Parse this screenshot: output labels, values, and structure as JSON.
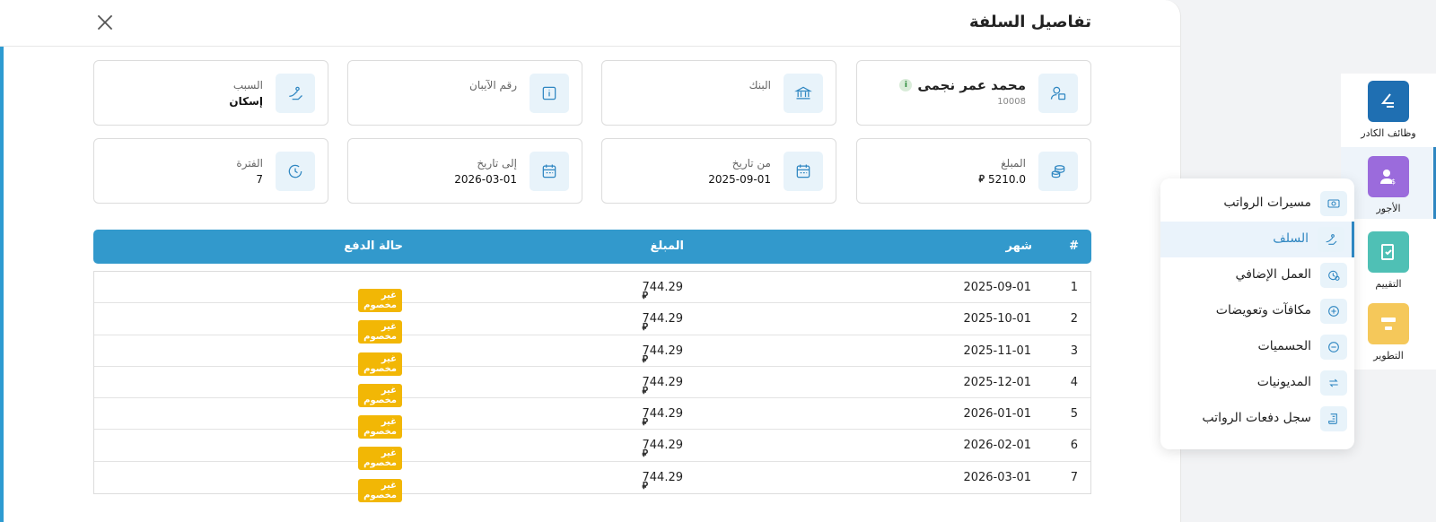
{
  "modal": {
    "title": "تفاصيل السلفة",
    "cards": {
      "employee": {
        "name": "محمد عمر نجمى",
        "id": "10008"
      },
      "bank": {
        "label": "البنك",
        "value": ""
      },
      "iban": {
        "label": "رقم الآيبان",
        "value": ""
      },
      "reason": {
        "label": "السبب",
        "value": "إسكان"
      },
      "amount": {
        "label": "المبلغ",
        "value": "5210.0"
      },
      "from_date": {
        "label": "من تاريخ",
        "value": "2025-09-01"
      },
      "to_date": {
        "label": "إلى تاريخ",
        "value": "2026-03-01"
      },
      "period": {
        "label": "الفترة",
        "value": "7"
      }
    },
    "table": {
      "headers": {
        "index": "#",
        "month": "شهر",
        "amount": "المبلغ",
        "status": "حالة الدفع"
      },
      "rows": [
        {
          "index": "1",
          "month": "2025-09-01",
          "amount": "744.29",
          "status": "غير مخصوم"
        },
        {
          "index": "2",
          "month": "2025-10-01",
          "amount": "744.29",
          "status": "غير مخصوم"
        },
        {
          "index": "3",
          "month": "2025-11-01",
          "amount": "744.29",
          "status": "غير مخصوم"
        },
        {
          "index": "4",
          "month": "2025-12-01",
          "amount": "744.29",
          "status": "غير مخصوم"
        },
        {
          "index": "5",
          "month": "2026-01-01",
          "amount": "744.29",
          "status": "غير مخصوم"
        },
        {
          "index": "6",
          "month": "2026-02-01",
          "amount": "744.29",
          "status": "غير مخصوم"
        },
        {
          "index": "7",
          "month": "2026-03-01",
          "amount": "744.29",
          "status": "غير مخصوم"
        }
      ]
    }
  },
  "currency_symbol": "⃁",
  "rail": {
    "items": [
      {
        "label": "وظائف الكادر",
        "icon": "staff-jobs-icon",
        "color": "#1f6fb2"
      },
      {
        "label": "الأجور",
        "icon": "wages-icon",
        "color": "#9b6bdc"
      },
      {
        "label": "التقييم",
        "icon": "evaluation-icon",
        "color": "#4fc0b5"
      },
      {
        "label": "التطوير",
        "icon": "development-icon",
        "color": "#f5c85a"
      }
    ]
  },
  "menu": {
    "items": [
      {
        "label": "مسيرات الرواتب",
        "icon": "payroll-icon",
        "active": false
      },
      {
        "label": "السلف",
        "icon": "advance-icon",
        "active": true
      },
      {
        "label": "العمل الإضافي",
        "icon": "overtime-icon",
        "active": false
      },
      {
        "label": "مكافآت وتعويضات",
        "icon": "plus-circle-icon",
        "active": false
      },
      {
        "label": "الحسميات",
        "icon": "minus-circle-icon",
        "active": false
      },
      {
        "label": "المديونيات",
        "icon": "repeat-icon",
        "active": false
      },
      {
        "label": "سجل دفعات الرواتب",
        "icon": "scroll-icon",
        "active": false
      }
    ]
  },
  "colors": {
    "accent": "#3299cc",
    "badge": "#f2b705"
  }
}
